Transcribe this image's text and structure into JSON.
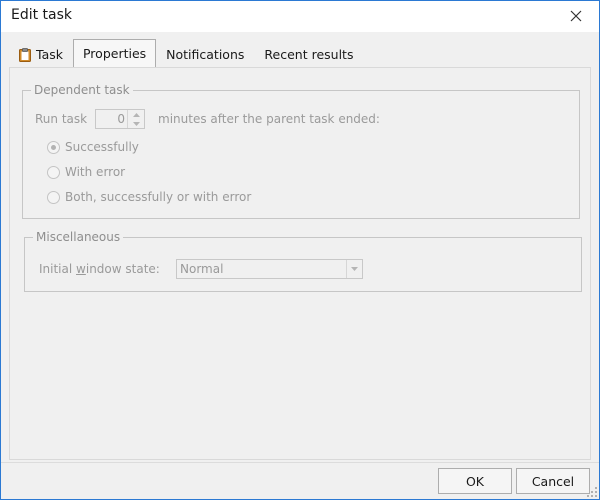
{
  "window": {
    "title": "Edit task"
  },
  "tabs": [
    {
      "label": "Task",
      "icon": "clipboard-icon",
      "active": false
    },
    {
      "label": "Properties",
      "active": true
    },
    {
      "label": "Notifications",
      "active": false
    },
    {
      "label": "Recent results",
      "active": false
    }
  ],
  "dependent_task": {
    "legend": "Dependent task",
    "run_task_label": "Run task",
    "minutes_value": "0",
    "minutes_suffix": "minutes after the parent task ended:",
    "options": [
      {
        "label": "Successfully",
        "checked": true
      },
      {
        "label": "With error",
        "checked": false
      },
      {
        "label": "Both, successfully or with error",
        "checked": false
      }
    ]
  },
  "misc": {
    "legend": "Miscellaneous",
    "window_state_label_pre": "Initial ",
    "window_state_label_accel": "w",
    "window_state_label_post": "indow state:",
    "window_state_value": "Normal"
  },
  "buttons": {
    "ok": "OK",
    "cancel": "Cancel"
  },
  "colors": {
    "accent_border": "#2b79d3",
    "disabled_text": "#9a9a9a"
  }
}
